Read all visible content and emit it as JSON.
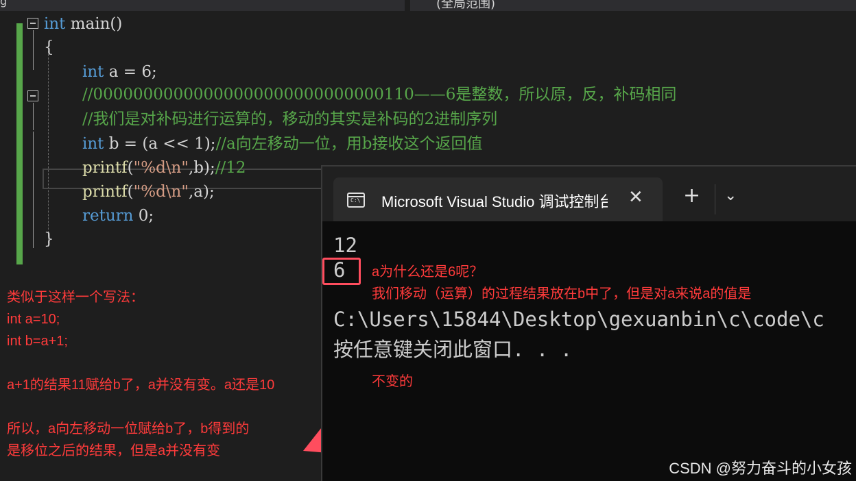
{
  "topbar": {
    "left_fragment": "g",
    "right_fragment": "(全局范围)"
  },
  "editor": {
    "lines": [
      {
        "kw": "int",
        "rest": " main()"
      },
      {
        "text": "{"
      },
      {
        "kw": "int",
        "rest": " a = 6;"
      },
      {
        "comment": "//00000000000000000000000000000110——6是整数，所以原，反，补码相同"
      },
      {
        "comment": "//我们是对补码进行运算的，移动的其实是补码的2进制序列"
      },
      {
        "kw": "int",
        "rest": " b = (a << 1);",
        "comment": "//a向左移动一位，用b接收这个返回值"
      },
      {
        "fn": "printf",
        "pre": "(",
        "str": "\"%d\\n\"",
        "rest": ",b);",
        "comment": "//12"
      },
      {
        "fn": "printf",
        "pre": "(",
        "str": "\"%d\\n\"",
        "rest": ",a);"
      },
      {
        "kw": "return",
        "rest": " 0;"
      },
      {
        "text": "}"
      }
    ]
  },
  "annotations": {
    "left_block": "类似于这样一个写法：\nint a=10;\nint b=a+1;\n\na+1的结果11赋给b了，a并没有变。a还是10\n\n所以，a向左移动一位赋给b了，b得到的\n是移位之后的结果，但是a并没有变",
    "right_block": "a为什么还是6呢？\n我们移动（运算）的过程结果放在b中了，但是对a来说a的值是\n\n\n\n不变的"
  },
  "terminal": {
    "tab_title": "Microsoft Visual Studio 调试控制台",
    "output_lines": [
      "12",
      "6",
      "C:\\Users\\15844\\Desktop\\gexuanbin\\c\\code\\c",
      "按任意键关闭此窗口. . ."
    ]
  },
  "watermark": "CSDN @努力奋斗的小女孩",
  "colors": {
    "keyword": "#569cd6",
    "comment": "#57a64a",
    "annotation": "#ff3b3b",
    "highlight_box": "#ff4d5e"
  }
}
